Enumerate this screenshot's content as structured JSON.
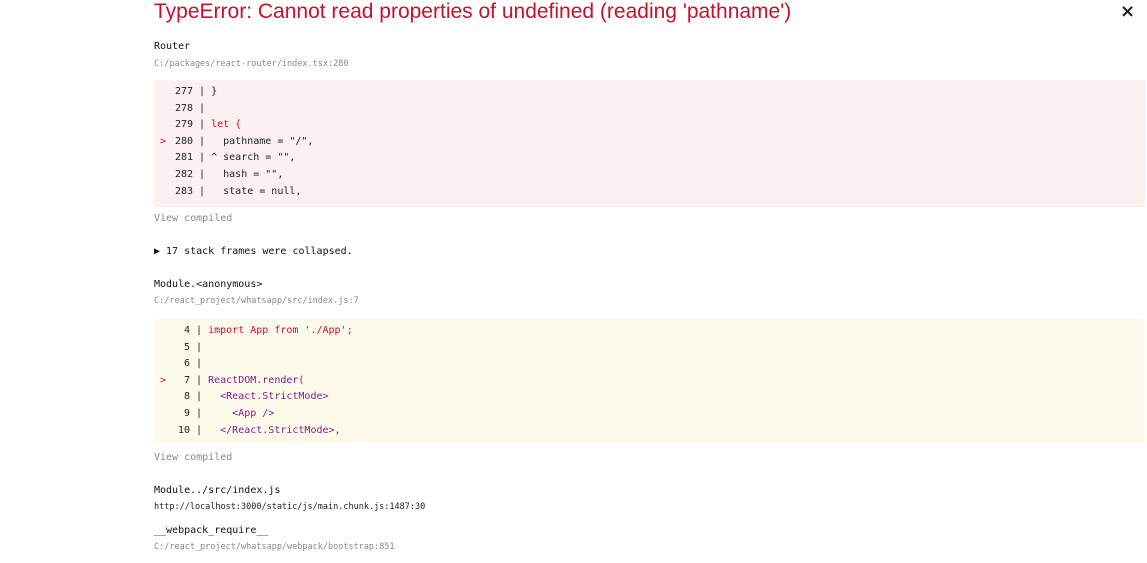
{
  "title": "TypeError: Cannot read properties of undefined (reading 'pathname')",
  "close_glyph": "×",
  "frames": [
    {
      "name": "Router",
      "location": "C:/packages/react-router/index.tsx:280",
      "code_lines": [
        {
          "marker": "",
          "num": "277",
          "text": "}"
        },
        {
          "marker": "",
          "num": "278",
          "text": ""
        },
        {
          "marker": "",
          "num": "279",
          "text": "let {"
        },
        {
          "marker": ">",
          "num": "280",
          "text": "  pathname = \"/\","
        },
        {
          "marker": "",
          "num": "281",
          "text": "^ search = \"\","
        },
        {
          "marker": "",
          "num": "282",
          "text": "  hash = \"\","
        },
        {
          "marker": "",
          "num": "283",
          "text": "  state = null,"
        }
      ],
      "view_compiled": "View compiled"
    },
    {
      "name": "Module.<anonymous>",
      "location": "C:/react_project/whatsapp/src/index.js:7",
      "code_lines": [
        {
          "marker": "",
          "num": "4",
          "text": "import App from './App';"
        },
        {
          "marker": "",
          "num": "5",
          "text": ""
        },
        {
          "marker": "",
          "num": "6",
          "text": ""
        },
        {
          "marker": ">",
          "num": "7",
          "text": "ReactDOM.render("
        },
        {
          "marker": "",
          "num": "8",
          "text": "  <React.StrictMode>"
        },
        {
          "marker": "",
          "num": "9",
          "text": "    <App />"
        },
        {
          "marker": "",
          "num": "10",
          "text": "  </React.StrictMode>,"
        }
      ],
      "view_compiled": "View compiled"
    },
    {
      "name": "Module../src/index.js",
      "location": "http://localhost:3000/static/js/main.chunk.js:1487:30"
    },
    {
      "name": "__webpack_require__",
      "location": "C:/react_project/whatsapp/webpack/bootstrap:851"
    }
  ],
  "collapsed_frames": "▶ 17 stack frames were collapsed."
}
